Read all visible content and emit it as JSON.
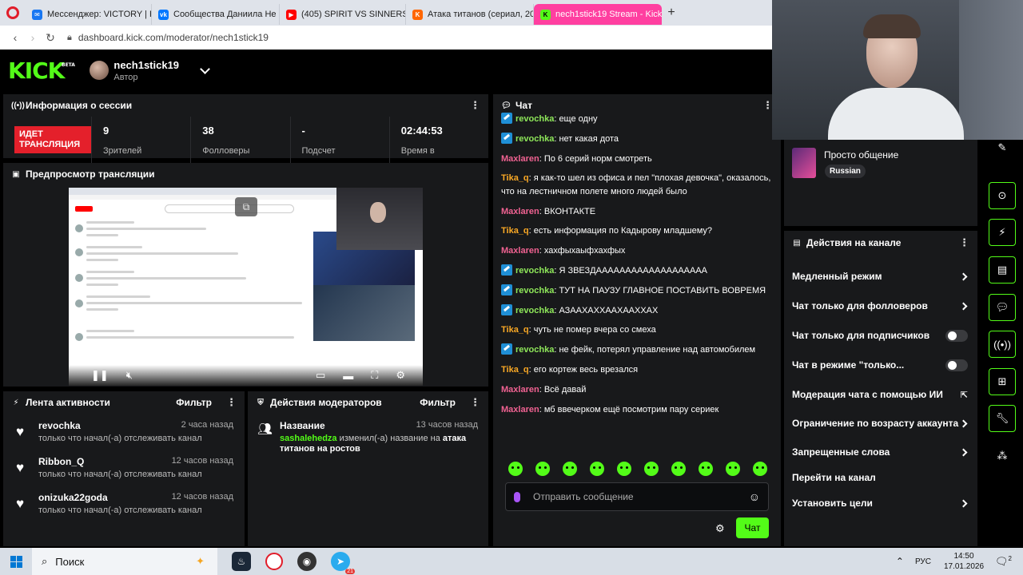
{
  "browser": {
    "tabs": [
      {
        "label": "Мессенджер: VICTORY | Р",
        "icon": "messenger-icon",
        "color": "#1877f2",
        "glyph": "✉"
      },
      {
        "label": "Сообщества Даниила Не",
        "icon": "vk-icon",
        "color": "#0077ff",
        "glyph": "vk"
      },
      {
        "label": "(405) SPIRIT VS SINNERS",
        "icon": "youtube-icon",
        "color": "#ff0000",
        "glyph": "▶"
      },
      {
        "label": "Атака титанов (сериал, 20",
        "icon": "kinopoisk-icon",
        "color": "#f60",
        "glyph": "K"
      },
      {
        "label": "nech1stick19 Stream - Kick",
        "icon": "kick-icon",
        "color": "#53fc18",
        "glyph": "K"
      }
    ],
    "url": "dashboard.kick.com/moderator/nech1stick19"
  },
  "header": {
    "logo": "KICK",
    "logo_badge": "BETA",
    "username": "nech1stick19",
    "role": "Автор"
  },
  "session": {
    "title": "Информация о сессии",
    "live_label": "ИДЕТ ТРАНСЛЯЦИЯ",
    "stats": [
      {
        "value": "9",
        "label": "Зрителей"
      },
      {
        "value": "38",
        "label": "Фолловеры"
      },
      {
        "value": "-",
        "label": "Подсчет"
      },
      {
        "value": "02:44:53",
        "label": "Время в"
      }
    ]
  },
  "preview": {
    "title": "Предпросмотр трансляции"
  },
  "activity": {
    "title": "Лента активности",
    "filter": "Фильтр",
    "items": [
      {
        "user": "revochka",
        "time": "2 часа назад",
        "desc": "только что начал(-а) отслеживать канал"
      },
      {
        "user": "Ribbon_Q",
        "time": "12 часов назад",
        "desc": "только что начал(-а) отслеживать канал"
      },
      {
        "user": "onizuka22goda",
        "time": "12 часов назад",
        "desc": "только что начал(-а) отслеживать канал"
      }
    ]
  },
  "mod_actions": {
    "title": "Действия модераторов",
    "filter": "Фильтр",
    "item": {
      "title": "Название",
      "time": "13 часов назад",
      "user": "sashalehedza",
      "action": "изменил(-а) название на",
      "value": "атака титанов на ростов"
    }
  },
  "chat": {
    "title": "Чат",
    "messages": [
      {
        "user": "revochka",
        "color": "#8fe85a",
        "badge": true,
        "text": "еще одну"
      },
      {
        "user": "revochka",
        "color": "#8fe85a",
        "badge": true,
        "text": "нет какая дота"
      },
      {
        "user": "Maxlaren",
        "color": "#f06292",
        "badge": false,
        "text": "По 6 серий норм смотреть"
      },
      {
        "user": "Tika_q",
        "color": "#f9a825",
        "badge": false,
        "text": "я как-то шел из офиса и пел \"плохая девочка\", оказалось, что на лестничном полете много людей было"
      },
      {
        "user": "Maxlaren",
        "color": "#f06292",
        "badge": false,
        "text": "ВКОНТАКТЕ"
      },
      {
        "user": "Tika_q",
        "color": "#f9a825",
        "badge": false,
        "text": "есть информация по Кадырову младшему?"
      },
      {
        "user": "Maxlaren",
        "color": "#f06292",
        "badge": false,
        "text": "хахфыхаыфхахфых"
      },
      {
        "user": "revochka",
        "color": "#8fe85a",
        "badge": true,
        "text": "Я ЗВЕЗДААААААААААААААААААА"
      },
      {
        "user": "revochka",
        "color": "#8fe85a",
        "badge": true,
        "text": "ТУТ НА ПАУЗУ ГЛАВНОЕ ПОСТАВИТЬ ВОВРЕМЯ"
      },
      {
        "user": "revochka",
        "color": "#8fe85a",
        "badge": true,
        "text": "АЗААХАХХААХААХХАХ"
      },
      {
        "user": "Tika_q",
        "color": "#f9a825",
        "badge": false,
        "text": "чуть не помер вчера со смеха"
      },
      {
        "user": "revochka",
        "color": "#8fe85a",
        "badge": true,
        "text": "не фейк, потерял управление над автомобилем"
      },
      {
        "user": "Tika_q",
        "color": "#f9a825",
        "badge": false,
        "text": "его кортеж весь врезался"
      },
      {
        "user": "Maxlaren",
        "color": "#f06292",
        "badge": false,
        "text": "Всё давай"
      },
      {
        "user": "Maxlaren",
        "color": "#f06292",
        "badge": false,
        "text": "мб ввечерком ещё посмотрим пару сериек"
      }
    ],
    "placeholder": "Отправить сообщение",
    "send_label": "Чат"
  },
  "stream_info": {
    "category": "Просто общение",
    "language": "Russian"
  },
  "channel_actions": {
    "title": "Действия на канале",
    "rows": [
      {
        "label": "Медленный режим",
        "control": "arrow"
      },
      {
        "label": "Чат только для фолловеров",
        "control": "arrow"
      },
      {
        "label": "Чат только для подписчиков",
        "control": "toggle"
      },
      {
        "label": "Чат в режиме \"только...",
        "control": "toggle"
      },
      {
        "label": "Модерация чата с помощью ИИ",
        "control": "external"
      },
      {
        "label": "Ограничение по возрасту аккаунта",
        "control": "arrow"
      },
      {
        "label": "Запрещенные слова",
        "control": "arrow"
      },
      {
        "label": "Перейти на канал",
        "control": "none"
      },
      {
        "label": "Установить цели",
        "control": "arrow"
      }
    ]
  },
  "taskbar": {
    "search": "Поиск",
    "lang": "РУС",
    "time": "14:50",
    "date": "17.01.2026",
    "notifications": "2",
    "telegram_badge": "21"
  }
}
